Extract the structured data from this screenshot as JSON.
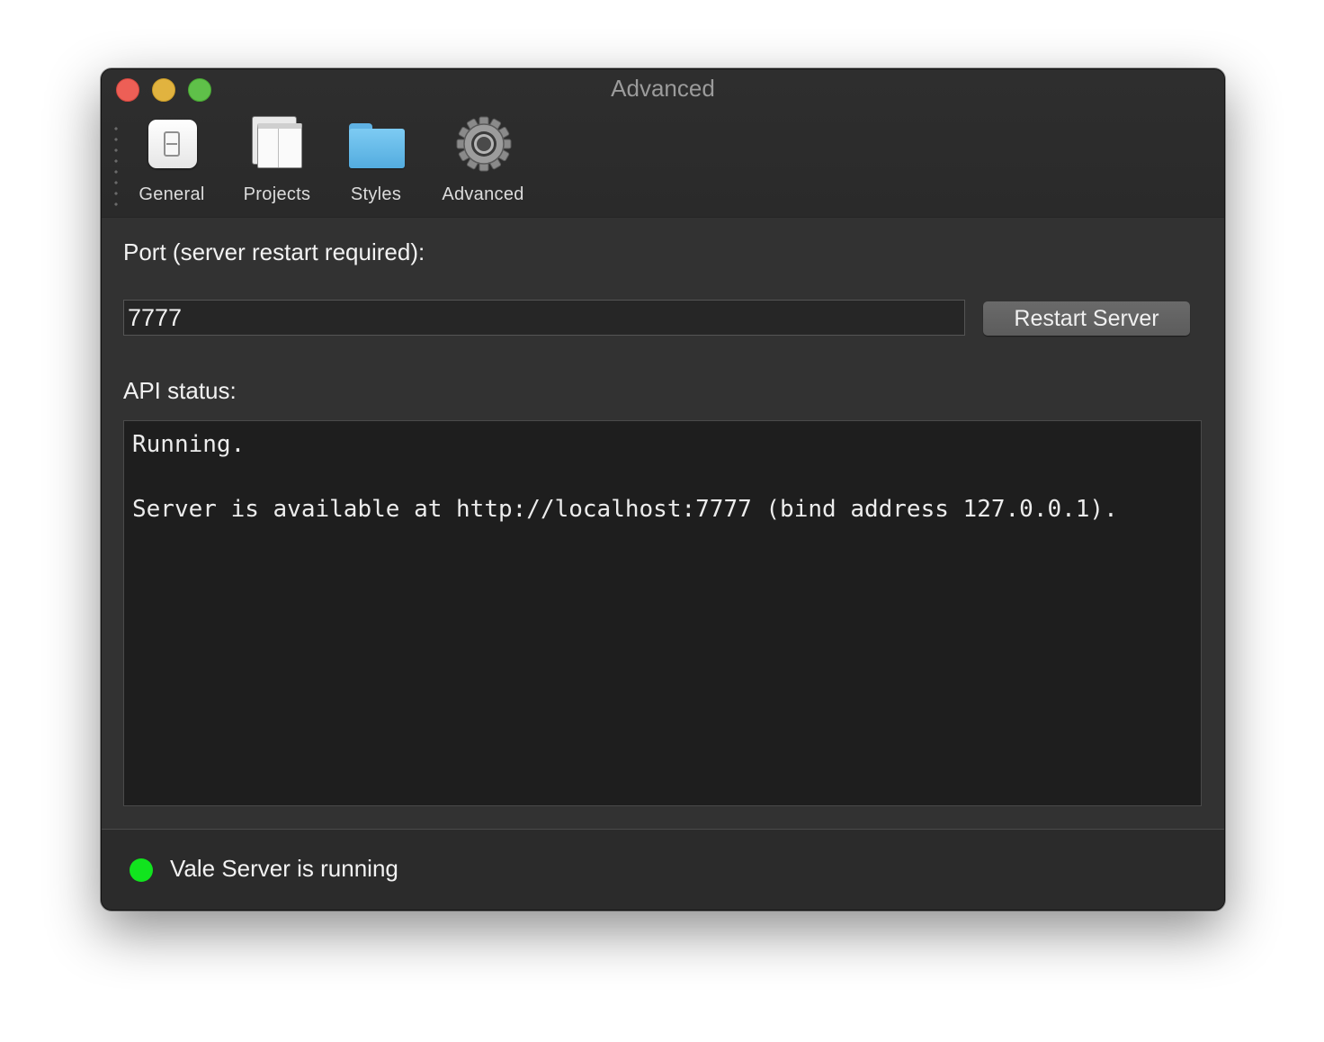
{
  "window": {
    "title": "Advanced"
  },
  "toolbar": {
    "items": [
      {
        "label": "General",
        "icon": "switch-icon"
      },
      {
        "label": "Projects",
        "icon": "windows-icon"
      },
      {
        "label": "Styles",
        "icon": "folder-icon"
      },
      {
        "label": "Advanced",
        "icon": "gear-icon"
      }
    ]
  },
  "port": {
    "label": "Port (server restart required):",
    "value": "7777",
    "restart_label": "Restart Server"
  },
  "api": {
    "label": "API status:",
    "lines": [
      "Running.",
      "",
      "Server is available at http://localhost:7777 (bind address 127.0.0.1)."
    ]
  },
  "footer": {
    "status_text": "Vale Server is running",
    "status_color": "#11e41e"
  }
}
